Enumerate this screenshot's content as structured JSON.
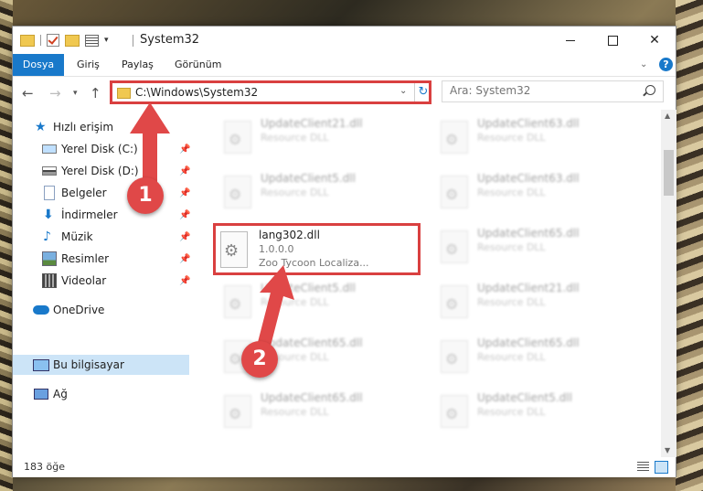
{
  "window": {
    "title": "System32"
  },
  "ribbon": {
    "tabs": [
      "Dosya",
      "Giriş",
      "Paylaş",
      "Görünüm"
    ]
  },
  "address": {
    "path": "C:\\Windows\\System32"
  },
  "search": {
    "placeholder": "Ara: System32"
  },
  "sidebar": {
    "items": [
      {
        "label": "Hızlı erişim",
        "icon": "star-icon"
      },
      {
        "label": "Yerel Disk (C:)",
        "icon": "drive-icon",
        "pinned": true
      },
      {
        "label": "Yerel Disk (D:)",
        "icon": "drive-icon",
        "pinned": true
      },
      {
        "label": "Belgeler",
        "icon": "document-icon",
        "pinned": true
      },
      {
        "label": "İndirmeler",
        "icon": "download-icon",
        "pinned": true
      },
      {
        "label": "Müzik",
        "icon": "music-icon",
        "pinned": true
      },
      {
        "label": "Resimler",
        "icon": "pictures-icon",
        "pinned": true
      },
      {
        "label": "Videolar",
        "icon": "video-icon",
        "pinned": true
      },
      {
        "label": "OneDrive",
        "icon": "cloud-icon"
      },
      {
        "label": "Bu bilgisayar",
        "icon": "computer-icon",
        "selected": true
      },
      {
        "label": "Ağ",
        "icon": "network-icon"
      }
    ]
  },
  "files": {
    "highlighted": {
      "name": "lang302.dll",
      "version": "1.0.0.0",
      "description": "Zoo Tycoon Localiza..."
    },
    "blurred": [
      {
        "name": "UpdateClient21.dll",
        "type": "Resource DLL"
      },
      {
        "name": "UpdateClient63.dll",
        "type": "Resource DLL"
      },
      {
        "name": "UpdateClient5.dll",
        "type": "Resource DLL"
      },
      {
        "name": "UpdateClient63.dll",
        "type": "Resource DLL"
      },
      {
        "name": "UpdateClient65.dll",
        "type": "Resource DLL"
      },
      {
        "name": "UpdateClient5.dll",
        "type": "Resource DLL"
      },
      {
        "name": "UpdateClient21.dll",
        "type": "Resource DLL"
      },
      {
        "name": "UpdateClient65.dll",
        "type": "Resource DLL"
      },
      {
        "name": "UpdateClient65.dll",
        "type": "Resource DLL"
      },
      {
        "name": "UpdateClient65.dll",
        "type": "Resource DLL"
      },
      {
        "name": "UpdateClient5.dll",
        "type": "Resource DLL"
      }
    ]
  },
  "status": {
    "item_count": "183 öğe"
  },
  "annotations": {
    "step1": "1",
    "step2": "2",
    "color": "#e04848"
  },
  "colors": {
    "accent": "#1979ca",
    "highlight_border": "#d94040",
    "selection": "#cce4f7"
  }
}
